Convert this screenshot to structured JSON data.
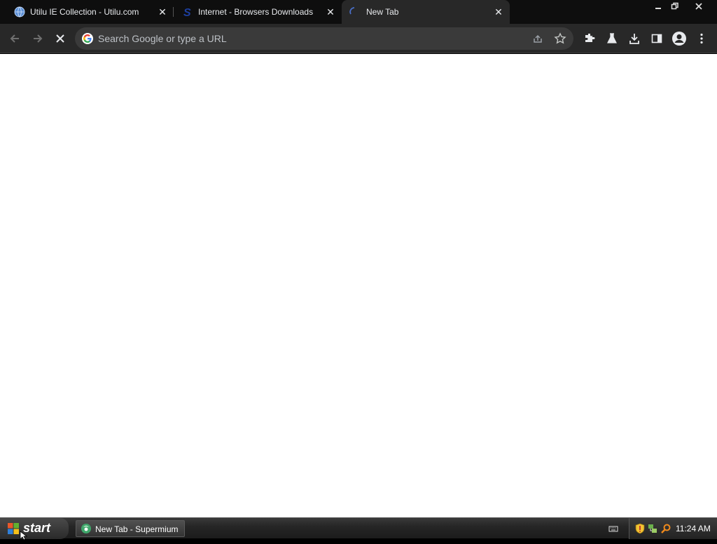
{
  "browser": {
    "tabs": [
      {
        "label": "Utilu IE Collection - Utilu.com",
        "favicon": "globe-icon",
        "active": false
      },
      {
        "label": "Internet - Browsers Downloads",
        "favicon": "s-logo-icon",
        "active": false
      },
      {
        "label": "New Tab",
        "favicon": "loading-spinner-icon",
        "active": true
      }
    ],
    "window_controls": [
      "minimize-icon",
      "restore-icon",
      "close-icon"
    ],
    "toolbar": {
      "back": "back-arrow-icon",
      "forward": "forward-arrow-icon",
      "stop": "stop-loading-icon",
      "omnibox": {
        "placeholder": "Search Google or type a URL",
        "value": ""
      },
      "right_icons": [
        "share-icon",
        "bookmark-star-icon",
        "extensions-icon",
        "labs-flask-icon",
        "download-icon",
        "side-panel-icon",
        "profile-avatar-icon",
        "menu-kebab-icon"
      ]
    },
    "colors": {
      "tabstrip": "#0e0e0e",
      "toolbar": "#282828",
      "omnibox": "#3a3a3a",
      "text": "#e8eaed"
    }
  },
  "taskbar": {
    "start_label": "start",
    "items": [
      {
        "label": "New Tab - Supermium"
      }
    ],
    "tray_icons": [
      "keyboard-icon",
      "security-shield-icon",
      "network-icon",
      "search-icon"
    ],
    "clock": "11:24 AM"
  }
}
